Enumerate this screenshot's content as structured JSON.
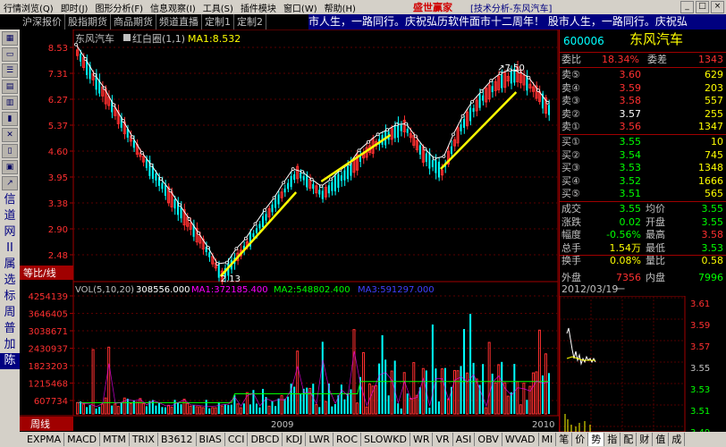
{
  "menu": {
    "items": [
      "行情浏览(Q)",
      "即时(J)",
      "图形分析(F)",
      "信息观察(I)",
      "工具(S)",
      "插件模块",
      "窗口(W)",
      "帮助(H)"
    ],
    "brand": "盛世赢家",
    "window_title": "[技术分析-东风汽车]"
  },
  "tabs": [
    "沪深报价",
    "股指期货",
    "商品期货",
    "频道直播",
    "定制1",
    "定制2"
  ],
  "ticker_text": "市人生，一路同行。庆祝弘历软件面市十二周年！  股市人生，一路同行。庆祝弘",
  "left_tools": {
    "icon_buttons": [
      "grid-icon",
      "window-icon",
      "list-icon",
      "table-icon",
      "chart-icon",
      "k-line-icon",
      "x-icon",
      "doc-icon",
      "news-icon",
      "arrow-icon"
    ],
    "chars": [
      "信",
      "道",
      "网",
      "II",
      "属",
      "选",
      "标",
      "周",
      "普",
      "加",
      "陈"
    ],
    "selected_char": "陈"
  },
  "price_chart": {
    "title_stock": "东风汽车",
    "indicator_name": "红白圈(1,1)",
    "ma_label": "MA1:8.532",
    "y_ticks": [
      "8.53",
      "7.31",
      "6.27",
      "5.37",
      "4.60",
      "3.95",
      "3.38",
      "2.90",
      "2.48"
    ],
    "high_label": "7.50",
    "low_label": "2.13",
    "ratio_tab": "等比/线"
  },
  "volume_chart": {
    "label": "VOL(5,10,20)",
    "value": "308556.000",
    "ma1": "MA1:372185.400",
    "ma2": "MA2:548802.400",
    "ma3": "MA3:591297.000",
    "y_ticks": [
      "4254139",
      "3646405",
      "3038671",
      "2430937",
      "1823203",
      "1215468",
      "607734"
    ],
    "period_tab": "周线",
    "x_labels": [
      "2009",
      "2010"
    ]
  },
  "quote": {
    "code": "600006",
    "name": "东风汽车",
    "wei_bi_label": "委比",
    "wei_bi": "18.34%",
    "wei_cha_label": "委差",
    "wei_cha": "1343",
    "sells": [
      {
        "label": "卖⑤",
        "price": "3.60",
        "vol": "629"
      },
      {
        "label": "卖④",
        "price": "3.59",
        "vol": "203"
      },
      {
        "label": "卖③",
        "price": "3.58",
        "vol": "557"
      },
      {
        "label": "卖②",
        "price": "3.57",
        "vol": "255"
      },
      {
        "label": "卖①",
        "price": "3.56",
        "vol": "1347"
      }
    ],
    "buys": [
      {
        "label": "买①",
        "price": "3.55",
        "vol": "10"
      },
      {
        "label": "买②",
        "price": "3.54",
        "vol": "745"
      },
      {
        "label": "买③",
        "price": "3.53",
        "vol": "1348"
      },
      {
        "label": "买④",
        "price": "3.52",
        "vol": "1666"
      },
      {
        "label": "买⑤",
        "price": "3.51",
        "vol": "565"
      }
    ],
    "stats": [
      {
        "l1": "成交",
        "v1": "3.55",
        "l2": "均价",
        "v2": "3.55",
        "c1": "#00ff00",
        "c2": "#00ff00"
      },
      {
        "l1": "涨跌",
        "v1": "0.02",
        "l2": "开盘",
        "v2": "3.55",
        "c1": "#00ff00",
        "c2": "#00ff00"
      },
      {
        "l1": "幅度",
        "v1": "-0.56%",
        "l2": "最高",
        "v2": "3.58",
        "c1": "#00ff00",
        "c2": "#ff3030"
      },
      {
        "l1": "总手",
        "v1": "1.54万",
        "l2": "最低",
        "v2": "3.53",
        "c1": "#ffff00",
        "c2": "#00ff00"
      },
      {
        "l1": "换手",
        "v1": "0.08%",
        "l2": "量比",
        "v2": "0.58",
        "c1": "#ffff00",
        "c2": "#ffff00"
      },
      {
        "l1": "外盘",
        "v1": "7356",
        "l2": "内盘",
        "v2": "7996",
        "c1": "#ff3030",
        "c2": "#00ff00"
      }
    ],
    "date": "2012/03/19",
    "mini_y": [
      "3.61",
      "3.59",
      "3.57",
      "3.55",
      "3.53",
      "3.51",
      "3.49"
    ]
  },
  "bottom_tabs": [
    "EXPMA",
    "MACD",
    "MTM",
    "TRIX",
    "B3612",
    "BIAS",
    "CCI",
    "DBCD",
    "KDJ",
    "LWR",
    "ROC",
    "SLOWKD",
    "WR",
    "VR",
    "ASI",
    "OBV",
    "WVAD",
    "MI"
  ],
  "bottom_right_tabs": [
    "笔",
    "价",
    "势",
    "指",
    "配",
    "财",
    "值",
    "成"
  ],
  "active_bottom_right": "势",
  "colors": {
    "up": "#ff3030",
    "down": "#00ffff",
    "accent": "#ffff00"
  }
}
